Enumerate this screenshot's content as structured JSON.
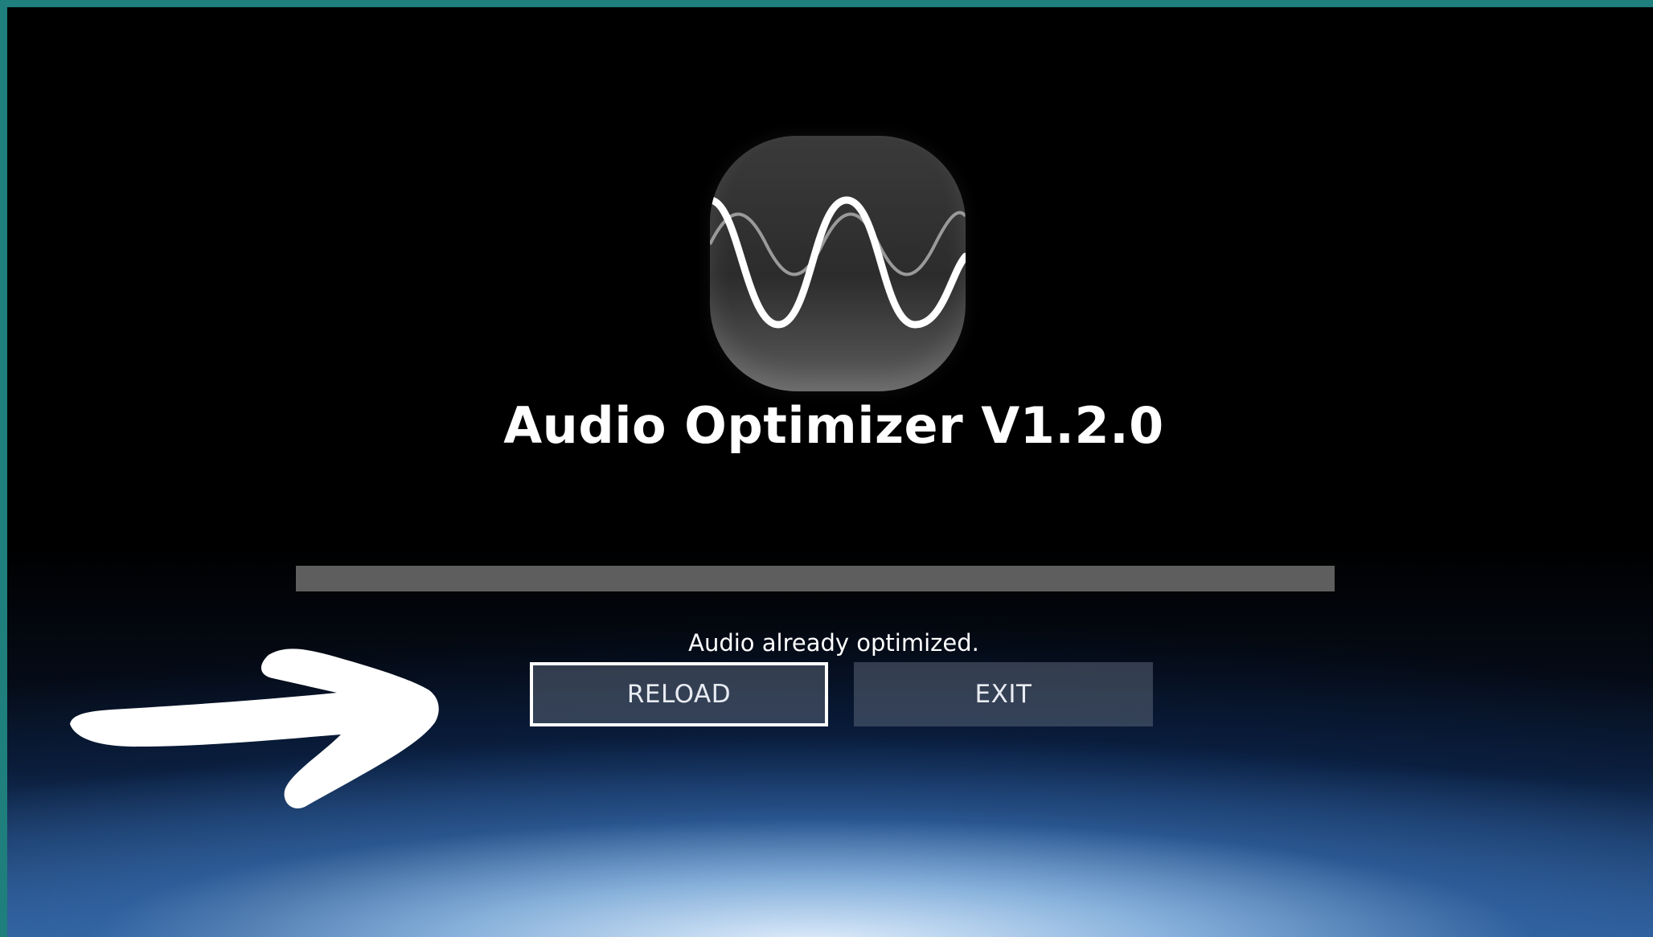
{
  "app": {
    "title": "Audio Optimizer V1.2.0",
    "icon": "sine-wave-icon"
  },
  "progress": {
    "value_fraction": 1.0
  },
  "status": {
    "message": "Audio already optimized."
  },
  "buttons": {
    "reload_label": "RELOAD",
    "exit_label": "EXIT",
    "focused": "RELOAD"
  },
  "annotation": {
    "icon": "hand-drawn-arrow-icon",
    "color": "#ffffff"
  },
  "colors": {
    "frame": "#1e7f7c",
    "progress_fill": "#5e5e5e",
    "button_bg": "#4a5466",
    "focus_border": "#ffffff"
  }
}
